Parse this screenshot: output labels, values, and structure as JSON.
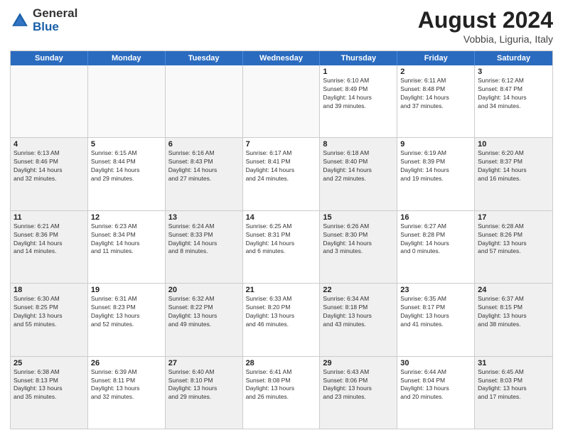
{
  "logo": {
    "general": "General",
    "blue": "Blue"
  },
  "title": {
    "month": "August 2024",
    "location": "Vobbia, Liguria, Italy"
  },
  "header_days": [
    "Sunday",
    "Monday",
    "Tuesday",
    "Wednesday",
    "Thursday",
    "Friday",
    "Saturday"
  ],
  "weeks": [
    [
      {
        "day": "",
        "info": "",
        "empty": true
      },
      {
        "day": "",
        "info": "",
        "empty": true
      },
      {
        "day": "",
        "info": "",
        "empty": true
      },
      {
        "day": "",
        "info": "",
        "empty": true
      },
      {
        "day": "1",
        "info": "Sunrise: 6:10 AM\nSunset: 8:49 PM\nDaylight: 14 hours\nand 39 minutes."
      },
      {
        "day": "2",
        "info": "Sunrise: 6:11 AM\nSunset: 8:48 PM\nDaylight: 14 hours\nand 37 minutes."
      },
      {
        "day": "3",
        "info": "Sunrise: 6:12 AM\nSunset: 8:47 PM\nDaylight: 14 hours\nand 34 minutes."
      }
    ],
    [
      {
        "day": "4",
        "info": "Sunrise: 6:13 AM\nSunset: 8:46 PM\nDaylight: 14 hours\nand 32 minutes.",
        "shaded": true
      },
      {
        "day": "5",
        "info": "Sunrise: 6:15 AM\nSunset: 8:44 PM\nDaylight: 14 hours\nand 29 minutes."
      },
      {
        "day": "6",
        "info": "Sunrise: 6:16 AM\nSunset: 8:43 PM\nDaylight: 14 hours\nand 27 minutes.",
        "shaded": true
      },
      {
        "day": "7",
        "info": "Sunrise: 6:17 AM\nSunset: 8:41 PM\nDaylight: 14 hours\nand 24 minutes."
      },
      {
        "day": "8",
        "info": "Sunrise: 6:18 AM\nSunset: 8:40 PM\nDaylight: 14 hours\nand 22 minutes.",
        "shaded": true
      },
      {
        "day": "9",
        "info": "Sunrise: 6:19 AM\nSunset: 8:39 PM\nDaylight: 14 hours\nand 19 minutes."
      },
      {
        "day": "10",
        "info": "Sunrise: 6:20 AM\nSunset: 8:37 PM\nDaylight: 14 hours\nand 16 minutes.",
        "shaded": true
      }
    ],
    [
      {
        "day": "11",
        "info": "Sunrise: 6:21 AM\nSunset: 8:36 PM\nDaylight: 14 hours\nand 14 minutes.",
        "shaded": true
      },
      {
        "day": "12",
        "info": "Sunrise: 6:23 AM\nSunset: 8:34 PM\nDaylight: 14 hours\nand 11 minutes."
      },
      {
        "day": "13",
        "info": "Sunrise: 6:24 AM\nSunset: 8:33 PM\nDaylight: 14 hours\nand 8 minutes.",
        "shaded": true
      },
      {
        "day": "14",
        "info": "Sunrise: 6:25 AM\nSunset: 8:31 PM\nDaylight: 14 hours\nand 6 minutes."
      },
      {
        "day": "15",
        "info": "Sunrise: 6:26 AM\nSunset: 8:30 PM\nDaylight: 14 hours\nand 3 minutes.",
        "shaded": true
      },
      {
        "day": "16",
        "info": "Sunrise: 6:27 AM\nSunset: 8:28 PM\nDaylight: 14 hours\nand 0 minutes."
      },
      {
        "day": "17",
        "info": "Sunrise: 6:28 AM\nSunset: 8:26 PM\nDaylight: 13 hours\nand 57 minutes.",
        "shaded": true
      }
    ],
    [
      {
        "day": "18",
        "info": "Sunrise: 6:30 AM\nSunset: 8:25 PM\nDaylight: 13 hours\nand 55 minutes.",
        "shaded": true
      },
      {
        "day": "19",
        "info": "Sunrise: 6:31 AM\nSunset: 8:23 PM\nDaylight: 13 hours\nand 52 minutes."
      },
      {
        "day": "20",
        "info": "Sunrise: 6:32 AM\nSunset: 8:22 PM\nDaylight: 13 hours\nand 49 minutes.",
        "shaded": true
      },
      {
        "day": "21",
        "info": "Sunrise: 6:33 AM\nSunset: 8:20 PM\nDaylight: 13 hours\nand 46 minutes."
      },
      {
        "day": "22",
        "info": "Sunrise: 6:34 AM\nSunset: 8:18 PM\nDaylight: 13 hours\nand 43 minutes.",
        "shaded": true
      },
      {
        "day": "23",
        "info": "Sunrise: 6:35 AM\nSunset: 8:17 PM\nDaylight: 13 hours\nand 41 minutes."
      },
      {
        "day": "24",
        "info": "Sunrise: 6:37 AM\nSunset: 8:15 PM\nDaylight: 13 hours\nand 38 minutes.",
        "shaded": true
      }
    ],
    [
      {
        "day": "25",
        "info": "Sunrise: 6:38 AM\nSunset: 8:13 PM\nDaylight: 13 hours\nand 35 minutes.",
        "shaded": true
      },
      {
        "day": "26",
        "info": "Sunrise: 6:39 AM\nSunset: 8:11 PM\nDaylight: 13 hours\nand 32 minutes."
      },
      {
        "day": "27",
        "info": "Sunrise: 6:40 AM\nSunset: 8:10 PM\nDaylight: 13 hours\nand 29 minutes.",
        "shaded": true
      },
      {
        "day": "28",
        "info": "Sunrise: 6:41 AM\nSunset: 8:08 PM\nDaylight: 13 hours\nand 26 minutes."
      },
      {
        "day": "29",
        "info": "Sunrise: 6:43 AM\nSunset: 8:06 PM\nDaylight: 13 hours\nand 23 minutes.",
        "shaded": true
      },
      {
        "day": "30",
        "info": "Sunrise: 6:44 AM\nSunset: 8:04 PM\nDaylight: 13 hours\nand 20 minutes."
      },
      {
        "day": "31",
        "info": "Sunrise: 6:45 AM\nSunset: 8:03 PM\nDaylight: 13 hours\nand 17 minutes.",
        "shaded": true
      }
    ]
  ]
}
